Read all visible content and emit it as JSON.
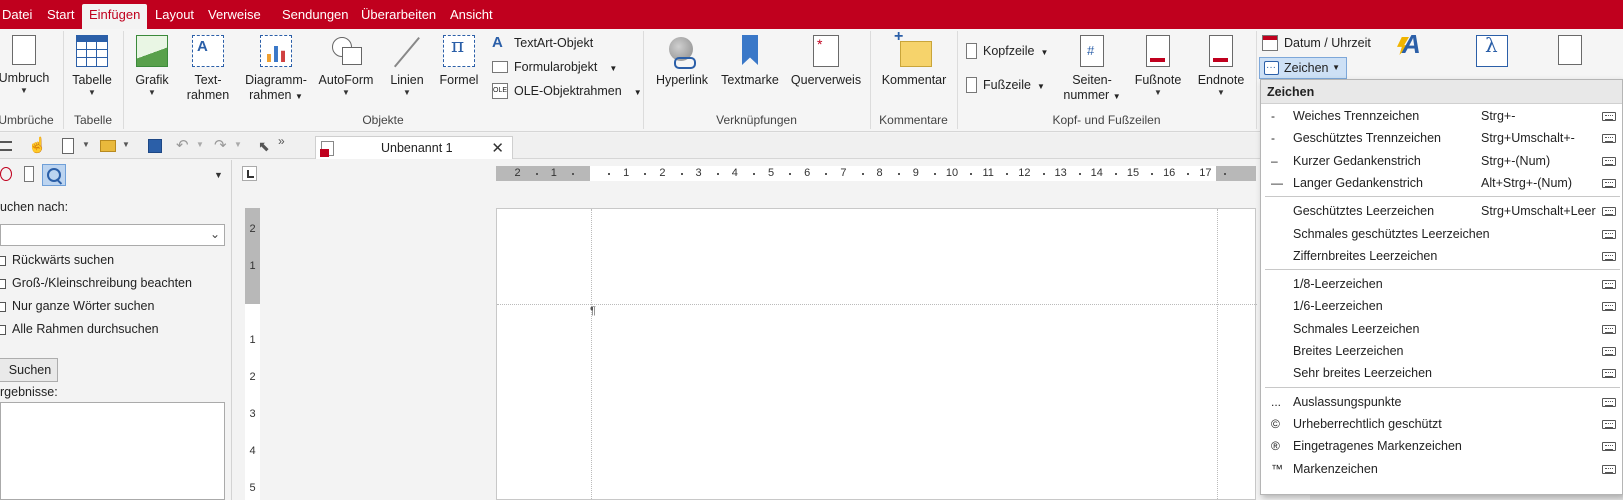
{
  "menu": {
    "tabs": [
      {
        "label": "Datei"
      },
      {
        "label": "Start"
      },
      {
        "label": "Einfügen"
      },
      {
        "label": "Layout"
      },
      {
        "label": "Verweise"
      },
      {
        "label": "Sendungen"
      },
      {
        "label": "Überarbeiten"
      },
      {
        "label": "Ansicht"
      }
    ],
    "active": "Einfügen",
    "accent_color": "#c0001e"
  },
  "ribbon": {
    "umbruch": {
      "label": "Umbruch"
    },
    "tabelle": {
      "label": "Tabelle"
    },
    "grafik": {
      "label": "Grafik"
    },
    "textrahmen": {
      "line1": "Text-",
      "line2": "rahmen"
    },
    "diagrammrahmen": {
      "line1": "Diagramm-",
      "line2": "rahmen"
    },
    "autoform": {
      "label": "AutoForm"
    },
    "linien": {
      "label": "Linien"
    },
    "formel": {
      "label": "Formel"
    },
    "textart": {
      "label": "TextArt-Objekt"
    },
    "formularobjekt": {
      "label": "Formularobjekt"
    },
    "ole": {
      "label": "OLE-Objektrahmen"
    },
    "hyperlink": {
      "label": "Hyperlink"
    },
    "textmarke": {
      "label": "Textmarke"
    },
    "querverweis": {
      "label": "Querverweis"
    },
    "kommentar": {
      "label": "Kommentar"
    },
    "kopfzeile": {
      "label": "Kopfzeile"
    },
    "fusszeile": {
      "label": "Fußzeile"
    },
    "seitennummer": {
      "line1": "Seiten-",
      "line2": "nummer"
    },
    "fussnote": {
      "label": "Fußnote"
    },
    "endnote": {
      "label": "Endnote"
    },
    "datum": {
      "label": "Datum / Uhrzeit"
    },
    "zeichen": {
      "label": "Zeichen"
    },
    "groups": {
      "umbrueche": "Umbrüche",
      "tabelle": "Tabelle",
      "objekte": "Objekte",
      "verknuepfungen": "Verknüpfungen",
      "kommentare": "Kommentare",
      "kopf_fuss": "Kopf- und Fußzeilen"
    }
  },
  "toolbar": {
    "document_tab": "Unbenannt 1",
    "close_glyph": "✕",
    "more_glyph": "»"
  },
  "search_panel": {
    "search_label": "uchen nach:",
    "search_value": "",
    "options": [
      {
        "label": "Rückwärts suchen"
      },
      {
        "label": "Groß-/Kleinschreibung beachten"
      },
      {
        "label": "Nur ganze Wörter suchen"
      },
      {
        "label": "Alle Rahmen durchsuchen"
      }
    ],
    "search_button": "Suchen",
    "results_label": "rgebnisse:"
  },
  "rulers": {
    "horizontal": [
      "2",
      "1",
      "1",
      "2",
      "3",
      "4",
      "5",
      "6",
      "7",
      "8",
      "9",
      "10",
      "11",
      "12",
      "13",
      "14",
      "15",
      "16",
      "17"
    ],
    "vertical": [
      "2",
      "1",
      "1",
      "2",
      "3",
      "4",
      "5"
    ]
  },
  "document": {
    "pilcrow": "¶"
  },
  "dropdown": {
    "title": "Zeichen",
    "groups": [
      [
        {
          "symbol": "-",
          "label": "Weiches Trennzeichen",
          "shortcut": "Strg+-"
        },
        {
          "symbol": "-",
          "label": "Geschütztes Trennzeichen",
          "shortcut": "Strg+Umschalt+-"
        },
        {
          "symbol": "–",
          "label": "Kurzer Gedankenstrich",
          "shortcut": "Strg+-(Num)"
        },
        {
          "symbol": "—",
          "label": "Langer Gedankenstrich",
          "shortcut": "Alt+Strg+-(Num)"
        }
      ],
      [
        {
          "symbol": "",
          "label": "Geschütztes Leerzeichen",
          "shortcut": "Strg+Umschalt+Leer"
        },
        {
          "symbol": "",
          "label": "Schmales geschütztes Leerzeichen",
          "shortcut": ""
        },
        {
          "symbol": "",
          "label": "Ziffernbreites Leerzeichen",
          "shortcut": ""
        }
      ],
      [
        {
          "symbol": "",
          "label": "1/8-Leerzeichen",
          "shortcut": ""
        },
        {
          "symbol": "",
          "label": "1/6-Leerzeichen",
          "shortcut": ""
        },
        {
          "symbol": "",
          "label": "Schmales Leerzeichen",
          "shortcut": ""
        },
        {
          "symbol": "",
          "label": "Breites Leerzeichen",
          "shortcut": ""
        },
        {
          "symbol": "",
          "label": "Sehr breites Leerzeichen",
          "shortcut": ""
        }
      ],
      [
        {
          "symbol": "...",
          "label": "Auslassungspunkte",
          "shortcut": ""
        },
        {
          "symbol": "©",
          "label": "Urheberrechtlich geschützt",
          "shortcut": ""
        },
        {
          "symbol": "®",
          "label": "Eingetragenes Markenzeichen",
          "shortcut": ""
        },
        {
          "symbol": "™",
          "label": "Markenzeichen",
          "shortcut": ""
        }
      ]
    ]
  }
}
